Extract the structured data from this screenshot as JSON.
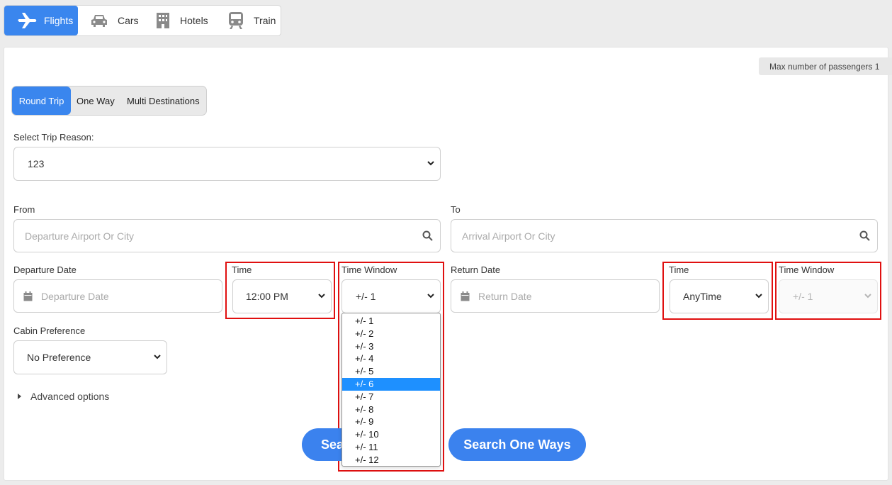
{
  "tabs": [
    {
      "label": "Flights",
      "icon": "airplane-icon",
      "active": true
    },
    {
      "label": "Cars",
      "icon": "car-icon",
      "active": false
    },
    {
      "label": "Hotels",
      "icon": "hotel-icon",
      "active": false
    },
    {
      "label": "Train",
      "icon": "train-icon",
      "active": false
    }
  ],
  "max_passengers": "Max number of passengers 1",
  "trip_types": [
    {
      "label": "Round Trip",
      "active": true
    },
    {
      "label": "One Way",
      "active": false
    },
    {
      "label": "Multi Destinations",
      "active": false
    }
  ],
  "trip_reason": {
    "label": "Select Trip Reason:",
    "value": "123"
  },
  "from": {
    "label": "From",
    "placeholder": "Departure Airport Or City"
  },
  "to": {
    "label": "To",
    "placeholder": "Arrival Airport Or City"
  },
  "departure": {
    "date_label": "Departure Date",
    "date_placeholder": "Departure Date",
    "time_label": "Time",
    "time_value": "12:00 PM",
    "window_label": "Time Window",
    "window_value": "+/- 1"
  },
  "return": {
    "date_label": "Return Date",
    "date_placeholder": "Return Date",
    "time_label": "Time",
    "time_value": "AnyTime",
    "window_label": "Time Window",
    "window_value": "+/- 1"
  },
  "cabin": {
    "label": "Cabin Preference",
    "value": "No Preference"
  },
  "advanced_options": "Advanced options",
  "time_window_options": [
    "+/- 1",
    "+/- 2",
    "+/- 3",
    "+/- 4",
    "+/- 5",
    "+/- 6",
    "+/- 7",
    "+/- 8",
    "+/- 9",
    "+/- 10",
    "+/- 11",
    "+/- 12"
  ],
  "time_window_highlighted": "+/- 6",
  "buttons": {
    "search_round_trip_partial": "Sea",
    "search_one_ways": "Search One Ways"
  },
  "colors": {
    "accent": "#3a86ee",
    "highlight_box": "#e01010",
    "selected_option": "#1e90ff"
  }
}
